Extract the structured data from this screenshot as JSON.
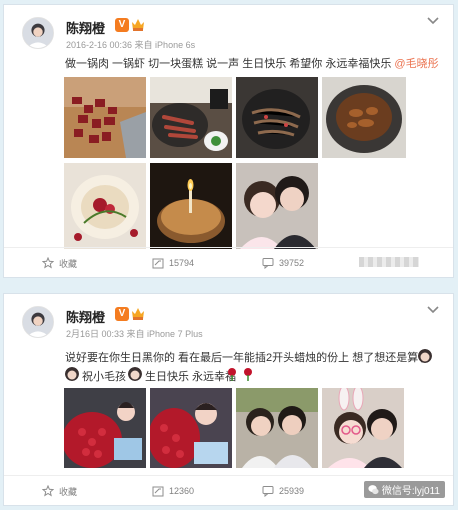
{
  "colors": {
    "page_bg": "#e3f0f6",
    "vip_badge": "#f47c20",
    "mention": "#eb7350"
  },
  "post1": {
    "username": "陈翔橙",
    "badge_icon": "verified-v-icon",
    "meta": "2016-2-16 00:36 来自 iPhone 6s",
    "text": "做一锅肉 一锅虾 切一块蛋糕 说一声 生日快乐 希望你 永远幸福快乐 ",
    "mention": "@毛晓彤",
    "images": [
      "meat-on-board",
      "sausages-in-pan",
      "dish-in-pan",
      "stir-fry-in-pot",
      "rose-cake",
      "candle-cake",
      "couple-selfie"
    ],
    "actions": {
      "favorite": "收藏",
      "repost_count": "15794",
      "comment_count": "39752"
    }
  },
  "post2": {
    "username": "陈翔橙",
    "meta": "2月16日 00:33 来自 iPhone 7 Plus",
    "line1": "说好要在你生日黑你的 看在最后一年能插2开头蜡烛的份上 想了想还是算了",
    "line2_a": "祝小毛孩",
    "line2_b": "生日快乐 永远幸福",
    "images": [
      "roses-and-cake-1",
      "roses-and-cake-2",
      "couple-photo",
      "bunny-filter-selfie"
    ],
    "actions": {
      "favorite": "收藏",
      "repost_count": "12360",
      "comment_count": "25939"
    },
    "watermark": "微信号:lyj011"
  }
}
